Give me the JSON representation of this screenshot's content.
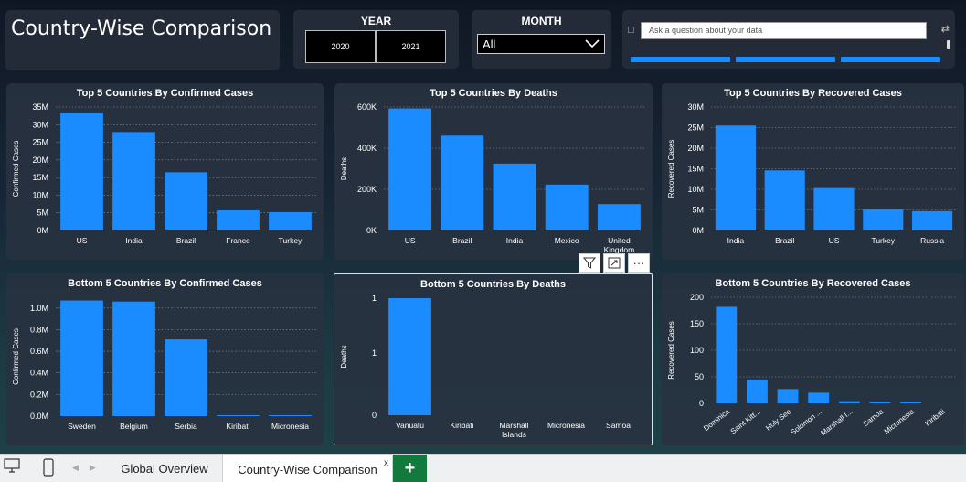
{
  "header": {
    "title": "Country-Wise Comparison"
  },
  "year_slicer": {
    "title": "YEAR",
    "options": [
      "2020",
      "2021"
    ]
  },
  "month_slicer": {
    "title": "MONTH",
    "selected": "All"
  },
  "qa": {
    "placeholder": "Ask a question about your data"
  },
  "colors": {
    "bar": "#1a8cff",
    "accent_tab": "#127a3c"
  },
  "tabs": {
    "items": [
      "Global Overview",
      "Country-Wise Comparison"
    ],
    "active": "Country-Wise Comparison",
    "close": "x",
    "add": "+"
  },
  "visual_tools": [
    "filter-icon",
    "focus-mode-icon",
    "more-options-icon"
  ],
  "chart_data": [
    {
      "type": "bar",
      "title": "Top 5 Countries By Confirmed Cases",
      "ylabel": "Confirmed Cases",
      "categories": [
        "US",
        "India",
        "Brazil",
        "France",
        "Turkey"
      ],
      "values": [
        33200000,
        27900000,
        16500000,
        5700000,
        5200000
      ],
      "ylim": [
        0,
        35000000
      ],
      "ticks": [
        0,
        5000000,
        10000000,
        15000000,
        20000000,
        25000000,
        30000000,
        35000000
      ],
      "tick_labels": [
        "0M",
        "5M",
        "10M",
        "15M",
        "20M",
        "25M",
        "30M",
        "35M"
      ],
      "grid": true
    },
    {
      "type": "bar",
      "title": "Top 5 Countries By Deaths",
      "ylabel": "Deaths",
      "categories": [
        "US",
        "Brazil",
        "India",
        "Mexico",
        "United Kingdom"
      ],
      "values": [
        593000,
        461000,
        325000,
        223000,
        128000
      ],
      "ylim": [
        0,
        600000
      ],
      "ticks": [
        0,
        200000,
        400000,
        600000
      ],
      "tick_labels": [
        "0K",
        "200K",
        "400K",
        "600K"
      ],
      "grid": true
    },
    {
      "type": "bar",
      "title": "Top 5 Countries By Recovered Cases",
      "ylabel": "Recovered Cases",
      "categories": [
        "India",
        "Brazil",
        "US",
        "Turkey",
        "Russia"
      ],
      "values": [
        25500000,
        14600000,
        10300000,
        5100000,
        4700000
      ],
      "ylim": [
        0,
        30000000
      ],
      "ticks": [
        0,
        5000000,
        10000000,
        15000000,
        20000000,
        25000000,
        30000000
      ],
      "tick_labels": [
        "0M",
        "5M",
        "10M",
        "15M",
        "20M",
        "25M",
        "30M"
      ],
      "grid": true
    },
    {
      "type": "bar",
      "title": "Bottom 5 Countries By Confirmed Cases",
      "ylabel": "Confirmed Cases",
      "categories": [
        "Sweden",
        "Belgium",
        "Serbia",
        "Kiribati",
        "Micronesia"
      ],
      "values": [
        1070000,
        1060000,
        710000,
        2,
        1
      ],
      "ylim": [
        0,
        1100000
      ],
      "ticks": [
        0,
        200000,
        400000,
        600000,
        800000,
        1000000
      ],
      "tick_labels": [
        "0.0M",
        "0.2M",
        "0.4M",
        "0.6M",
        "0.8M",
        "1.0M"
      ],
      "grid": true
    },
    {
      "type": "bar",
      "title": "Bottom 5 Countries By Deaths",
      "ylabel": "Deaths",
      "categories": [
        "Vanuatu",
        "Kiribati",
        "Marshall Islands",
        "Micronesia",
        "Samoa"
      ],
      "values": [
        1,
        0,
        0,
        0,
        0
      ],
      "ylim": [
        0,
        1
      ],
      "ticks": [
        0,
        1
      ],
      "extra_tick": 1,
      "tick_labels": [
        "0",
        "1"
      ],
      "grid": false
    },
    {
      "type": "bar",
      "title": "Bottom 5 Countries By Recovered Cases",
      "ylabel": "Recovered Cases",
      "categories": [
        "Dominica",
        "Saint Kitt...",
        "Holy See",
        "Solomon ...",
        "Marshall I...",
        "Samoa",
        "Micronesia",
        "Kiribati"
      ],
      "values": [
        182,
        45,
        27,
        20,
        4,
        3,
        1,
        0
      ],
      "ylim": [
        0,
        200
      ],
      "ticks": [
        0,
        50,
        100,
        150,
        200
      ],
      "tick_labels": [
        "0",
        "50",
        "100",
        "150",
        "200"
      ],
      "grid": true,
      "rotate_labels": true
    }
  ]
}
